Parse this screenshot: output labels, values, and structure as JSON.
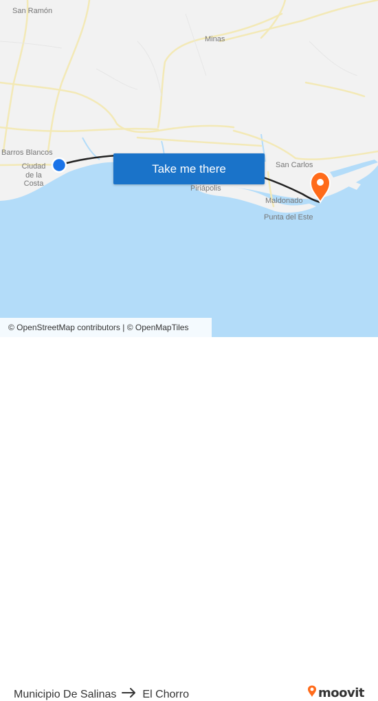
{
  "map": {
    "places": [
      {
        "key": "san-ramon",
        "label": "San Ramón"
      },
      {
        "key": "minas",
        "label": "Minas"
      },
      {
        "key": "barros-blancos",
        "label": "Barros Blancos"
      },
      {
        "key": "ciudad-de-la-costa",
        "label": "Ciudad de la Costa"
      },
      {
        "key": "san-carlos",
        "label": "San Carlos"
      },
      {
        "key": "piriapolis",
        "label": "Piriápolis"
      },
      {
        "key": "maldonado",
        "label": "Maldonado"
      },
      {
        "key": "punta-del-este",
        "label": "Punta del Este"
      }
    ],
    "colors": {
      "land": "#f2f2f2",
      "water": "#b3dcf9",
      "road": "#f3e9b6",
      "route": "#222222",
      "origin": "#1a73e8",
      "destination": "#ff6b1a"
    },
    "origin_marker": "origin-dot-icon",
    "destination_marker": "destination-pin-icon"
  },
  "cta": {
    "label": "Take me there"
  },
  "attribution": {
    "text": "© OpenStreetMap contributors | © OpenMapTiles"
  },
  "footer": {
    "origin": "Municipio De Salinas",
    "arrow_icon": "arrow-right-icon",
    "destination": "El Chorro",
    "brand": "moovit",
    "brand_color": "#ff6b1a"
  }
}
